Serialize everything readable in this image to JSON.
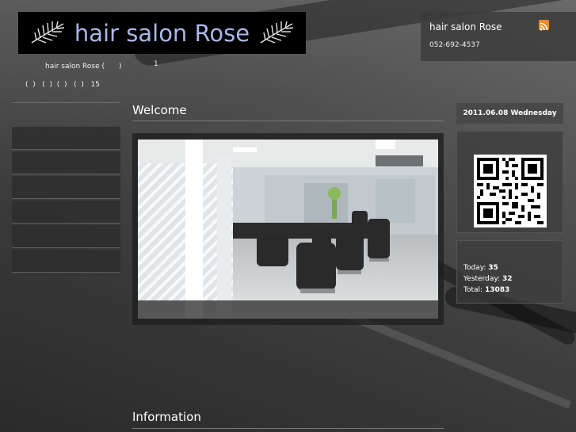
{
  "logo": {
    "text": "hair salon Rose"
  },
  "intro": {
    "site_desc": "hair salon Rose (　　)",
    "site_num": "1",
    "links": "(  )   (  )  (  )   (  )   15"
  },
  "header": {
    "title": "hair salon Rose",
    "phone": "052-692-4537",
    "rss_icon": "rss-icon"
  },
  "sidebar": {
    "menu_items": [
      "",
      "",
      "",
      "",
      "",
      ""
    ]
  },
  "main": {
    "welcome_heading": "Welcome",
    "information_heading": "Information"
  },
  "right": {
    "date": "2011.06.08 Wednesday",
    "counter": {
      "today_label": "Today:",
      "today_value": "35",
      "yesterday_label": "Yesterday:",
      "yesterday_value": "32",
      "total_label": "Total:",
      "total_value": "13083"
    }
  },
  "colors": {
    "logo_text": "#aab6e8",
    "rss": "#f08a24"
  }
}
